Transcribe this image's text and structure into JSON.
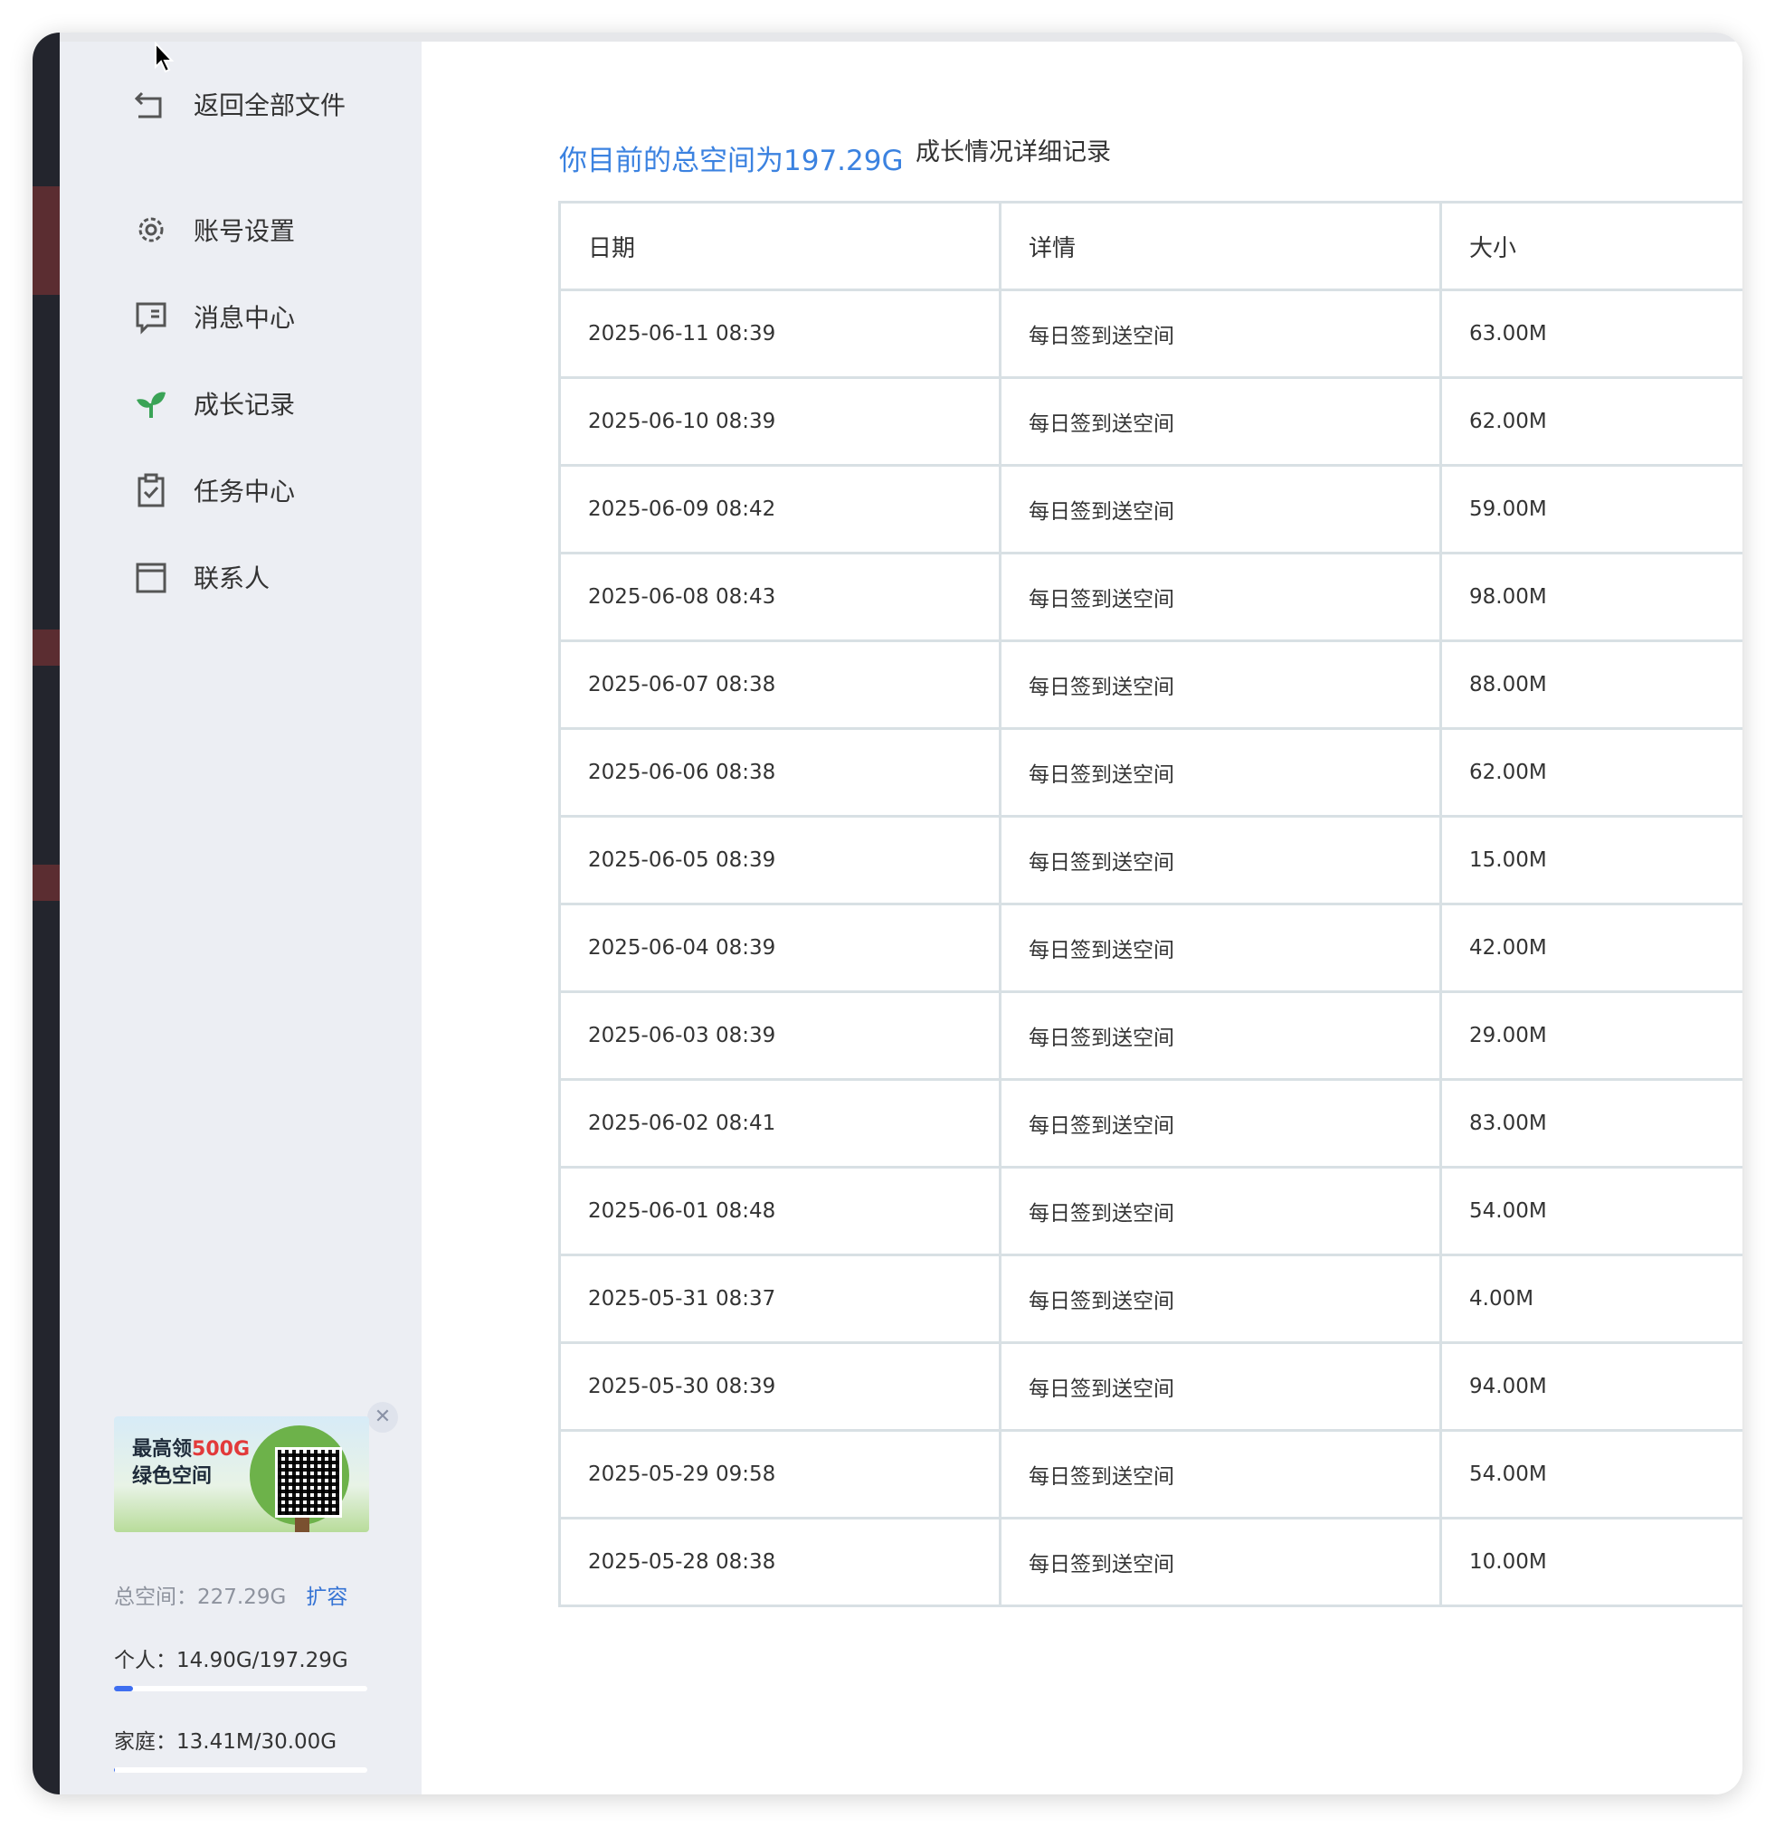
{
  "sidebar": {
    "back_label": "返回全部文件",
    "items": [
      {
        "label": "账号设置",
        "icon": "gear-icon"
      },
      {
        "label": "消息中心",
        "icon": "message-icon"
      },
      {
        "label": "成长记录",
        "icon": "sprout-icon"
      },
      {
        "label": "任务中心",
        "icon": "clipboard-check-icon"
      },
      {
        "label": "联系人",
        "icon": "contacts-icon"
      }
    ],
    "promo": {
      "line1_prefix": "最高领",
      "line1_highlight": "500G",
      "line2": "绿色空间"
    },
    "quota": {
      "total": "总空间：227.29G",
      "expand": "扩容",
      "personal": "个人：14.90G/197.29G",
      "personal_fraction": 0.076,
      "family": "家庭：13.41M/30.00G",
      "family_fraction": 0.0004
    }
  },
  "main": {
    "summary": "你目前的总空间为197.29G",
    "detail_link": "成长情况详细记录",
    "columns": [
      "日期",
      "详情",
      "大小"
    ],
    "rows": [
      [
        "2025-06-11 08:39",
        "每日签到送空间",
        "63.00M"
      ],
      [
        "2025-06-10 08:39",
        "每日签到送空间",
        "62.00M"
      ],
      [
        "2025-06-09 08:42",
        "每日签到送空间",
        "59.00M"
      ],
      [
        "2025-06-08 08:43",
        "每日签到送空间",
        "98.00M"
      ],
      [
        "2025-06-07 08:38",
        "每日签到送空间",
        "88.00M"
      ],
      [
        "2025-06-06 08:38",
        "每日签到送空间",
        "62.00M"
      ],
      [
        "2025-06-05 08:39",
        "每日签到送空间",
        "15.00M"
      ],
      [
        "2025-06-04 08:39",
        "每日签到送空间",
        "42.00M"
      ],
      [
        "2025-06-03 08:39",
        "每日签到送空间",
        "29.00M"
      ],
      [
        "2025-06-02 08:41",
        "每日签到送空间",
        "83.00M"
      ],
      [
        "2025-06-01 08:48",
        "每日签到送空间",
        "54.00M"
      ],
      [
        "2025-05-31 08:37",
        "每日签到送空间",
        "4.00M"
      ],
      [
        "2025-05-30 08:39",
        "每日签到送空间",
        "94.00M"
      ],
      [
        "2025-05-29 09:58",
        "每日签到送空间",
        "54.00M"
      ],
      [
        "2025-05-28 08:38",
        "每日签到送空间",
        "10.00M"
      ]
    ]
  },
  "colors": {
    "accent": "#3b82e0",
    "sprout": "#3aa356",
    "bar_fill": "#3e6ef0",
    "sidebar_bg": "#eceef3",
    "table_border": "#d8e0e4"
  }
}
